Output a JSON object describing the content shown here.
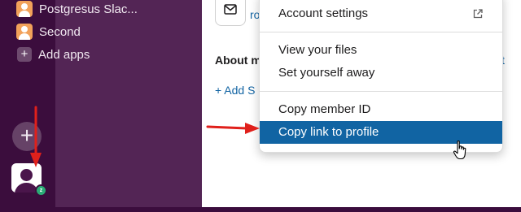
{
  "sidebar": {
    "items": [
      {
        "label": "Postgresus Slac...",
        "icon": "user-avatar-icon"
      },
      {
        "label": "Second",
        "icon": "user-avatar-icon"
      },
      {
        "label": "Add apps",
        "icon": "plus-icon"
      }
    ]
  },
  "rail": {
    "add_glyph": "+",
    "status_glyph": "z"
  },
  "main": {
    "about_fragment": "About m",
    "add_fragment": "+ Add S",
    "edit_fragment": "t",
    "link_fragment": "ro"
  },
  "menu": {
    "items": [
      {
        "label": "Account settings",
        "external": true
      },
      {
        "label": "View your files"
      },
      {
        "label": "Set yourself away"
      },
      {
        "label": "Copy member ID"
      },
      {
        "label": "Copy link to profile",
        "highlighted": true
      }
    ]
  },
  "colors": {
    "highlight": "#1164a3",
    "sidebar": "#532555",
    "rail": "#3b0d3d",
    "annotation_arrow": "#e0201b",
    "link": "#1264a3"
  }
}
